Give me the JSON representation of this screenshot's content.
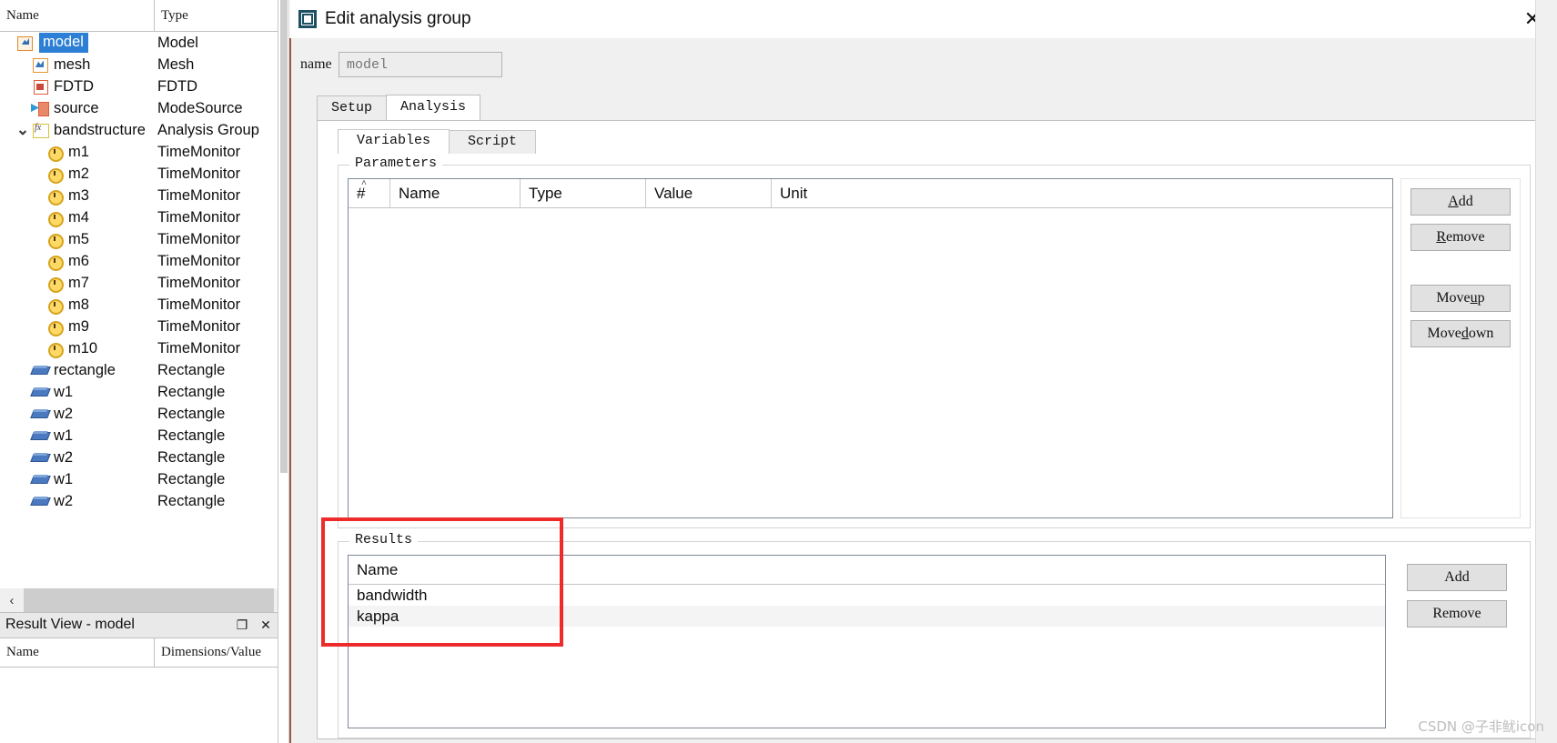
{
  "tree_panel": {
    "columns": [
      "Name",
      "Type"
    ],
    "rows": [
      {
        "name": "model",
        "type": "Model",
        "icon": "model-icon",
        "indent": 0,
        "twisty": "",
        "selected": true
      },
      {
        "name": "mesh",
        "type": "Mesh",
        "icon": "mesh-icon",
        "indent": 1,
        "twisty": "",
        "selected": false
      },
      {
        "name": "FDTD",
        "type": "FDTD",
        "icon": "fdtd-icon",
        "indent": 1,
        "twisty": "",
        "selected": false
      },
      {
        "name": "source",
        "type": "ModeSource",
        "icon": "source-icon",
        "indent": 1,
        "twisty": "",
        "selected": false
      },
      {
        "name": "bandstructure",
        "type": "Analysis Group",
        "icon": "function-icon",
        "indent": 1,
        "twisty": "v",
        "selected": false
      },
      {
        "name": "m1",
        "type": "TimeMonitor",
        "icon": "clock-icon",
        "indent": 2,
        "twisty": "",
        "selected": false
      },
      {
        "name": "m2",
        "type": "TimeMonitor",
        "icon": "clock-icon",
        "indent": 2,
        "twisty": "",
        "selected": false
      },
      {
        "name": "m3",
        "type": "TimeMonitor",
        "icon": "clock-icon",
        "indent": 2,
        "twisty": "",
        "selected": false
      },
      {
        "name": "m4",
        "type": "TimeMonitor",
        "icon": "clock-icon",
        "indent": 2,
        "twisty": "",
        "selected": false
      },
      {
        "name": "m5",
        "type": "TimeMonitor",
        "icon": "clock-icon",
        "indent": 2,
        "twisty": "",
        "selected": false
      },
      {
        "name": "m6",
        "type": "TimeMonitor",
        "icon": "clock-icon",
        "indent": 2,
        "twisty": "",
        "selected": false
      },
      {
        "name": "m7",
        "type": "TimeMonitor",
        "icon": "clock-icon",
        "indent": 2,
        "twisty": "",
        "selected": false
      },
      {
        "name": "m8",
        "type": "TimeMonitor",
        "icon": "clock-icon",
        "indent": 2,
        "twisty": "",
        "selected": false
      },
      {
        "name": "m9",
        "type": "TimeMonitor",
        "icon": "clock-icon",
        "indent": 2,
        "twisty": "",
        "selected": false
      },
      {
        "name": "m10",
        "type": "TimeMonitor",
        "icon": "clock-icon",
        "indent": 2,
        "twisty": "",
        "selected": false
      },
      {
        "name": "rectangle",
        "type": "Rectangle",
        "icon": "rectangle-icon",
        "indent": 1,
        "twisty": "",
        "selected": false
      },
      {
        "name": "w1",
        "type": "Rectangle",
        "icon": "rectangle-icon",
        "indent": 1,
        "twisty": "",
        "selected": false
      },
      {
        "name": "w2",
        "type": "Rectangle",
        "icon": "rectangle-icon",
        "indent": 1,
        "twisty": "",
        "selected": false
      },
      {
        "name": "w1",
        "type": "Rectangle",
        "icon": "rectangle-icon",
        "indent": 1,
        "twisty": "",
        "selected": false
      },
      {
        "name": "w2",
        "type": "Rectangle",
        "icon": "rectangle-icon",
        "indent": 1,
        "twisty": "",
        "selected": false
      },
      {
        "name": "w1",
        "type": "Rectangle",
        "icon": "rectangle-icon",
        "indent": 1,
        "twisty": "",
        "selected": false
      },
      {
        "name": "w2",
        "type": "Rectangle",
        "icon": "rectangle-icon",
        "indent": 1,
        "twisty": "",
        "selected": false
      }
    ],
    "scroll_left_arrow": "‹",
    "scroll_right_arrow": "›"
  },
  "result_view": {
    "title": "Result View - model",
    "restore_icon": "❐",
    "close_icon": "✕",
    "columns": [
      "Name",
      "Dimensions/Value"
    ]
  },
  "dialog": {
    "title": "Edit analysis group",
    "window_icon": "analysis-group-icon",
    "close_icon": "✕",
    "name_label": "name",
    "name_value": "",
    "name_placeholder": "model",
    "tabs": [
      {
        "label": "Setup",
        "active": false
      },
      {
        "label": "Analysis",
        "active": true
      }
    ],
    "inner_tabs": [
      {
        "label": "Variables",
        "active": true
      },
      {
        "label": "Script",
        "active": false
      }
    ],
    "parameters": {
      "legend": "Parameters",
      "columns": [
        "#",
        "Name",
        "Type",
        "Value",
        "Unit"
      ],
      "sort_marker": "˄",
      "rows": [],
      "buttons": [
        {
          "label": "Add",
          "accel": "A",
          "before": "",
          "after": "dd"
        },
        {
          "label": "Remove",
          "accel": "R",
          "before": "",
          "after": "emove"
        },
        {
          "label": "Move up",
          "accel": "u",
          "before": "Move ",
          "after": "p"
        },
        {
          "label": "Move down",
          "accel": "d",
          "before": "Move ",
          "after": "own"
        }
      ]
    },
    "results": {
      "legend": "Results",
      "columns": [
        "Name"
      ],
      "rows": [
        {
          "name": "bandwidth"
        },
        {
          "name": "kappa"
        }
      ],
      "buttons": [
        {
          "label": "Add"
        },
        {
          "label": "Remove"
        }
      ]
    }
  },
  "annotation": {
    "highlight_color": "#ee2b2b"
  },
  "watermark": {
    "text": "CSDN @子非鱿icon"
  }
}
